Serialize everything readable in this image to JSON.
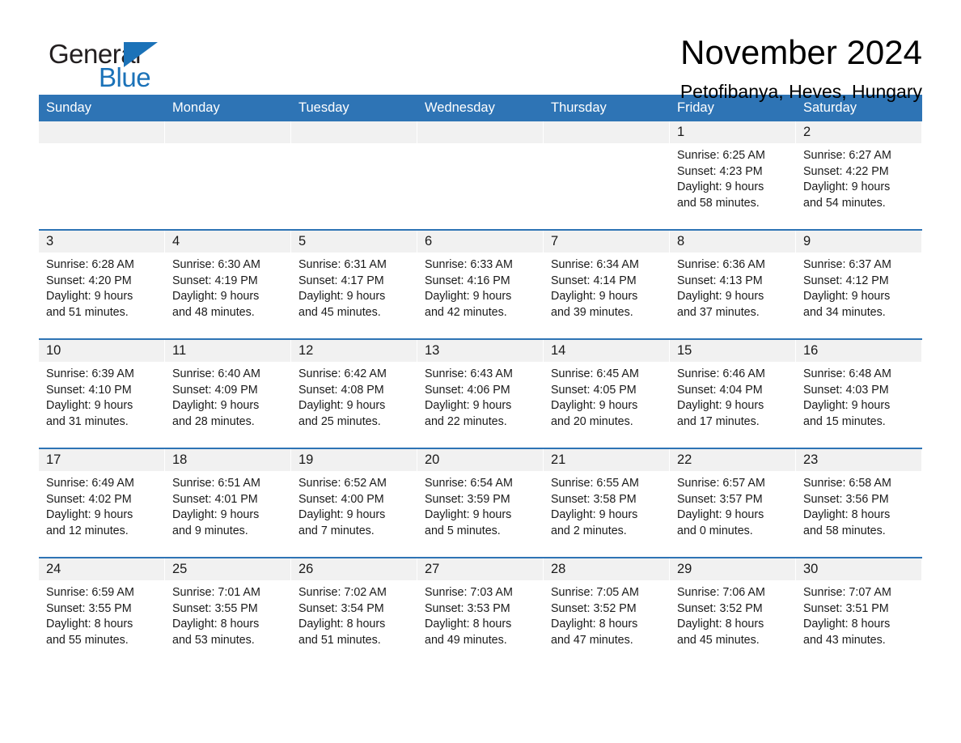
{
  "logo": {
    "word_one": "General",
    "word_two": "Blue",
    "accent_color": "#1b72b8"
  },
  "header": {
    "title": "November 2024",
    "location": "Petofibanya, Heves, Hungary"
  },
  "calendar": {
    "header_color": "#2e74b5",
    "daynum_bg": "#f1f1f1",
    "weekday_headers": [
      "Sunday",
      "Monday",
      "Tuesday",
      "Wednesday",
      "Thursday",
      "Friday",
      "Saturday"
    ],
    "weeks": [
      [
        {
          "day": "",
          "lines": []
        },
        {
          "day": "",
          "lines": []
        },
        {
          "day": "",
          "lines": []
        },
        {
          "day": "",
          "lines": []
        },
        {
          "day": "",
          "lines": []
        },
        {
          "day": "1",
          "lines": [
            "Sunrise: 6:25 AM",
            "Sunset: 4:23 PM",
            "Daylight: 9 hours",
            "and 58 minutes."
          ]
        },
        {
          "day": "2",
          "lines": [
            "Sunrise: 6:27 AM",
            "Sunset: 4:22 PM",
            "Daylight: 9 hours",
            "and 54 minutes."
          ]
        }
      ],
      [
        {
          "day": "3",
          "lines": [
            "Sunrise: 6:28 AM",
            "Sunset: 4:20 PM",
            "Daylight: 9 hours",
            "and 51 minutes."
          ]
        },
        {
          "day": "4",
          "lines": [
            "Sunrise: 6:30 AM",
            "Sunset: 4:19 PM",
            "Daylight: 9 hours",
            "and 48 minutes."
          ]
        },
        {
          "day": "5",
          "lines": [
            "Sunrise: 6:31 AM",
            "Sunset: 4:17 PM",
            "Daylight: 9 hours",
            "and 45 minutes."
          ]
        },
        {
          "day": "6",
          "lines": [
            "Sunrise: 6:33 AM",
            "Sunset: 4:16 PM",
            "Daylight: 9 hours",
            "and 42 minutes."
          ]
        },
        {
          "day": "7",
          "lines": [
            "Sunrise: 6:34 AM",
            "Sunset: 4:14 PM",
            "Daylight: 9 hours",
            "and 39 minutes."
          ]
        },
        {
          "day": "8",
          "lines": [
            "Sunrise: 6:36 AM",
            "Sunset: 4:13 PM",
            "Daylight: 9 hours",
            "and 37 minutes."
          ]
        },
        {
          "day": "9",
          "lines": [
            "Sunrise: 6:37 AM",
            "Sunset: 4:12 PM",
            "Daylight: 9 hours",
            "and 34 minutes."
          ]
        }
      ],
      [
        {
          "day": "10",
          "lines": [
            "Sunrise: 6:39 AM",
            "Sunset: 4:10 PM",
            "Daylight: 9 hours",
            "and 31 minutes."
          ]
        },
        {
          "day": "11",
          "lines": [
            "Sunrise: 6:40 AM",
            "Sunset: 4:09 PM",
            "Daylight: 9 hours",
            "and 28 minutes."
          ]
        },
        {
          "day": "12",
          "lines": [
            "Sunrise: 6:42 AM",
            "Sunset: 4:08 PM",
            "Daylight: 9 hours",
            "and 25 minutes."
          ]
        },
        {
          "day": "13",
          "lines": [
            "Sunrise: 6:43 AM",
            "Sunset: 4:06 PM",
            "Daylight: 9 hours",
            "and 22 minutes."
          ]
        },
        {
          "day": "14",
          "lines": [
            "Sunrise: 6:45 AM",
            "Sunset: 4:05 PM",
            "Daylight: 9 hours",
            "and 20 minutes."
          ]
        },
        {
          "day": "15",
          "lines": [
            "Sunrise: 6:46 AM",
            "Sunset: 4:04 PM",
            "Daylight: 9 hours",
            "and 17 minutes."
          ]
        },
        {
          "day": "16",
          "lines": [
            "Sunrise: 6:48 AM",
            "Sunset: 4:03 PM",
            "Daylight: 9 hours",
            "and 15 minutes."
          ]
        }
      ],
      [
        {
          "day": "17",
          "lines": [
            "Sunrise: 6:49 AM",
            "Sunset: 4:02 PM",
            "Daylight: 9 hours",
            "and 12 minutes."
          ]
        },
        {
          "day": "18",
          "lines": [
            "Sunrise: 6:51 AM",
            "Sunset: 4:01 PM",
            "Daylight: 9 hours",
            "and 9 minutes."
          ]
        },
        {
          "day": "19",
          "lines": [
            "Sunrise: 6:52 AM",
            "Sunset: 4:00 PM",
            "Daylight: 9 hours",
            "and 7 minutes."
          ]
        },
        {
          "day": "20",
          "lines": [
            "Sunrise: 6:54 AM",
            "Sunset: 3:59 PM",
            "Daylight: 9 hours",
            "and 5 minutes."
          ]
        },
        {
          "day": "21",
          "lines": [
            "Sunrise: 6:55 AM",
            "Sunset: 3:58 PM",
            "Daylight: 9 hours",
            "and 2 minutes."
          ]
        },
        {
          "day": "22",
          "lines": [
            "Sunrise: 6:57 AM",
            "Sunset: 3:57 PM",
            "Daylight: 9 hours",
            "and 0 minutes."
          ]
        },
        {
          "day": "23",
          "lines": [
            "Sunrise: 6:58 AM",
            "Sunset: 3:56 PM",
            "Daylight: 8 hours",
            "and 58 minutes."
          ]
        }
      ],
      [
        {
          "day": "24",
          "lines": [
            "Sunrise: 6:59 AM",
            "Sunset: 3:55 PM",
            "Daylight: 8 hours",
            "and 55 minutes."
          ]
        },
        {
          "day": "25",
          "lines": [
            "Sunrise: 7:01 AM",
            "Sunset: 3:55 PM",
            "Daylight: 8 hours",
            "and 53 minutes."
          ]
        },
        {
          "day": "26",
          "lines": [
            "Sunrise: 7:02 AM",
            "Sunset: 3:54 PM",
            "Daylight: 8 hours",
            "and 51 minutes."
          ]
        },
        {
          "day": "27",
          "lines": [
            "Sunrise: 7:03 AM",
            "Sunset: 3:53 PM",
            "Daylight: 8 hours",
            "and 49 minutes."
          ]
        },
        {
          "day": "28",
          "lines": [
            "Sunrise: 7:05 AM",
            "Sunset: 3:52 PM",
            "Daylight: 8 hours",
            "and 47 minutes."
          ]
        },
        {
          "day": "29",
          "lines": [
            "Sunrise: 7:06 AM",
            "Sunset: 3:52 PM",
            "Daylight: 8 hours",
            "and 45 minutes."
          ]
        },
        {
          "day": "30",
          "lines": [
            "Sunrise: 7:07 AM",
            "Sunset: 3:51 PM",
            "Daylight: 8 hours",
            "and 43 minutes."
          ]
        }
      ]
    ]
  }
}
